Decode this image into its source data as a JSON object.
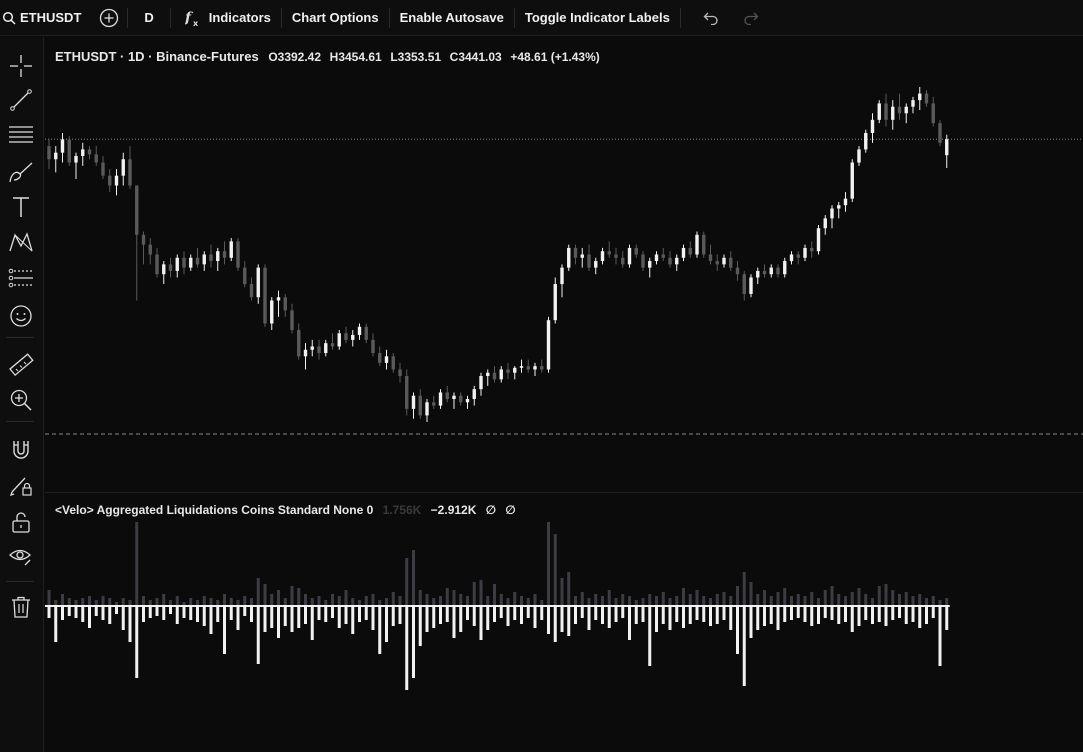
{
  "toolbar": {
    "symbol": "ETHUSDT",
    "interval": "D",
    "indicators_label": "Indicators",
    "chart_options_label": "Chart Options",
    "autosave_label": "Enable Autosave",
    "toggle_labels_label": "Toggle Indicator Labels"
  },
  "sidebar": {
    "tools": [
      "crosshair-icon",
      "trendline-icon",
      "fib-lines-icon",
      "brush-icon",
      "text-icon",
      "pattern-icon",
      "forecast-icon",
      "emoji-icon",
      "ruler-icon",
      "zoom-in-icon",
      "magnet-icon",
      "lock-drawing-icon",
      "unlock-icon",
      "eye-icon",
      "trash-icon"
    ]
  },
  "legend": {
    "title": "ETHUSDT · 1D · Binance-Futures",
    "open": "O3392.42",
    "high": "H3454.61",
    "low": "L3353.51",
    "close": "C3441.03",
    "change": "+48.61 (+1.43%)"
  },
  "indicator": {
    "name": "<Velo> Aggregated Liquidations Coins Standard None 0",
    "value1": "1.756K",
    "value2": "−2.912K",
    "value3": "∅",
    "value4": "∅"
  },
  "chart_data": {
    "type": "candlestick",
    "ohlc": [
      [
        3420,
        3440,
        3350,
        3380
      ],
      [
        3380,
        3420,
        3340,
        3400
      ],
      [
        3400,
        3460,
        3370,
        3440
      ],
      [
        3440,
        3450,
        3360,
        3370
      ],
      [
        3370,
        3400,
        3320,
        3390
      ],
      [
        3390,
        3430,
        3360,
        3410
      ],
      [
        3410,
        3420,
        3380,
        3395
      ],
      [
        3395,
        3420,
        3360,
        3370
      ],
      [
        3370,
        3390,
        3320,
        3330
      ],
      [
        3330,
        3350,
        3280,
        3300
      ],
      [
        3300,
        3350,
        3270,
        3330
      ],
      [
        3330,
        3400,
        3300,
        3380
      ],
      [
        3380,
        3420,
        3290,
        3300
      ],
      [
        3300,
        3300,
        2950,
        3150
      ],
      [
        3150,
        3160,
        3060,
        3120
      ],
      [
        3120,
        3140,
        3060,
        3090
      ],
      [
        3090,
        3110,
        3020,
        3030
      ],
      [
        3030,
        3070,
        3000,
        3060
      ],
      [
        3060,
        3080,
        3020,
        3040
      ],
      [
        3040,
        3090,
        3020,
        3080
      ],
      [
        3080,
        3100,
        3030,
        3050
      ],
      [
        3050,
        3090,
        3040,
        3080
      ],
      [
        3080,
        3110,
        3050,
        3060
      ],
      [
        3060,
        3100,
        3040,
        3090
      ],
      [
        3090,
        3120,
        3050,
        3070
      ],
      [
        3070,
        3110,
        3040,
        3100
      ],
      [
        3100,
        3130,
        3060,
        3080
      ],
      [
        3080,
        3140,
        3070,
        3130
      ],
      [
        3130,
        3140,
        3040,
        3050
      ],
      [
        3050,
        3070,
        2990,
        3000
      ],
      [
        3000,
        3020,
        2950,
        2960
      ],
      [
        2960,
        3060,
        2940,
        3050
      ],
      [
        3050,
        3060,
        2870,
        2880
      ],
      [
        2880,
        2960,
        2860,
        2950
      ],
      [
        2950,
        2980,
        2900,
        2960
      ],
      [
        2960,
        2970,
        2900,
        2920
      ],
      [
        2920,
        2940,
        2850,
        2860
      ],
      [
        2860,
        2880,
        2770,
        2780
      ],
      [
        2780,
        2820,
        2740,
        2800
      ],
      [
        2800,
        2830,
        2780,
        2810
      ],
      [
        2810,
        2830,
        2770,
        2790
      ],
      [
        2790,
        2830,
        2780,
        2820
      ],
      [
        2820,
        2850,
        2800,
        2810
      ],
      [
        2810,
        2860,
        2800,
        2850
      ],
      [
        2850,
        2870,
        2820,
        2830
      ],
      [
        2830,
        2860,
        2810,
        2845
      ],
      [
        2845,
        2880,
        2830,
        2870
      ],
      [
        2870,
        2880,
        2820,
        2830
      ],
      [
        2830,
        2850,
        2780,
        2790
      ],
      [
        2790,
        2810,
        2750,
        2760
      ],
      [
        2760,
        2800,
        2740,
        2780
      ],
      [
        2780,
        2790,
        2730,
        2740
      ],
      [
        2740,
        2760,
        2700,
        2720
      ],
      [
        2720,
        2740,
        2600,
        2620
      ],
      [
        2620,
        2670,
        2590,
        2660
      ],
      [
        2660,
        2680,
        2590,
        2600
      ],
      [
        2600,
        2650,
        2580,
        2640
      ],
      [
        2640,
        2660,
        2620,
        2630
      ],
      [
        2630,
        2680,
        2620,
        2670
      ],
      [
        2670,
        2690,
        2640,
        2650
      ],
      [
        2650,
        2670,
        2620,
        2660
      ],
      [
        2660,
        2670,
        2630,
        2640
      ],
      [
        2640,
        2660,
        2620,
        2650
      ],
      [
        2650,
        2690,
        2630,
        2680
      ],
      [
        2680,
        2730,
        2660,
        2720
      ],
      [
        2720,
        2740,
        2690,
        2730
      ],
      [
        2730,
        2750,
        2700,
        2710
      ],
      [
        2710,
        2750,
        2700,
        2740
      ],
      [
        2740,
        2760,
        2710,
        2730
      ],
      [
        2730,
        2750,
        2710,
        2745
      ],
      [
        2745,
        2770,
        2730,
        2750
      ],
      [
        2750,
        2770,
        2730,
        2740
      ],
      [
        2740,
        2760,
        2720,
        2750
      ],
      [
        2750,
        2770,
        2730,
        2740
      ],
      [
        2740,
        2900,
        2730,
        2890
      ],
      [
        2890,
        3020,
        2880,
        3000
      ],
      [
        3000,
        3060,
        2960,
        3050
      ],
      [
        3050,
        3120,
        3040,
        3110
      ],
      [
        3110,
        3120,
        3060,
        3080
      ],
      [
        3080,
        3110,
        3050,
        3090
      ],
      [
        3090,
        3120,
        3040,
        3050
      ],
      [
        3050,
        3080,
        3030,
        3070
      ],
      [
        3070,
        3110,
        3060,
        3100
      ],
      [
        3100,
        3130,
        3080,
        3090
      ],
      [
        3090,
        3110,
        3060,
        3080
      ],
      [
        3080,
        3100,
        3050,
        3060
      ],
      [
        3060,
        3120,
        3050,
        3110
      ],
      [
        3110,
        3120,
        3080,
        3090
      ],
      [
        3090,
        3100,
        3040,
        3050
      ],
      [
        3050,
        3080,
        3020,
        3070
      ],
      [
        3070,
        3100,
        3060,
        3090
      ],
      [
        3090,
        3110,
        3070,
        3080
      ],
      [
        3080,
        3100,
        3050,
        3060
      ],
      [
        3060,
        3090,
        3040,
        3080
      ],
      [
        3080,
        3120,
        3070,
        3110
      ],
      [
        3110,
        3130,
        3080,
        3090
      ],
      [
        3090,
        3160,
        3080,
        3150
      ],
      [
        3150,
        3160,
        3080,
        3090
      ],
      [
        3090,
        3120,
        3060,
        3070
      ],
      [
        3070,
        3090,
        3040,
        3060
      ],
      [
        3060,
        3090,
        3050,
        3080
      ],
      [
        3080,
        3100,
        3040,
        3050
      ],
      [
        3050,
        3070,
        3010,
        3030
      ],
      [
        3030,
        3040,
        2950,
        2970
      ],
      [
        2970,
        3030,
        2960,
        3020
      ],
      [
        3020,
        3050,
        3000,
        3040
      ],
      [
        3040,
        3060,
        3020,
        3030
      ],
      [
        3030,
        3060,
        3020,
        3050
      ],
      [
        3050,
        3060,
        3020,
        3030
      ],
      [
        3030,
        3080,
        3020,
        3070
      ],
      [
        3070,
        3100,
        3060,
        3090
      ],
      [
        3090,
        3100,
        3060,
        3080
      ],
      [
        3080,
        3120,
        3070,
        3110
      ],
      [
        3110,
        3130,
        3080,
        3100
      ],
      [
        3100,
        3180,
        3090,
        3170
      ],
      [
        3170,
        3210,
        3150,
        3200
      ],
      [
        3200,
        3240,
        3170,
        3230
      ],
      [
        3230,
        3250,
        3200,
        3240
      ],
      [
        3240,
        3280,
        3220,
        3260
      ],
      [
        3260,
        3380,
        3250,
        3370
      ],
      [
        3370,
        3420,
        3360,
        3410
      ],
      [
        3410,
        3470,
        3400,
        3460
      ],
      [
        3460,
        3520,
        3430,
        3500
      ],
      [
        3500,
        3560,
        3490,
        3550
      ],
      [
        3550,
        3580,
        3480,
        3500
      ],
      [
        3500,
        3560,
        3470,
        3540
      ],
      [
        3540,
        3580,
        3500,
        3520
      ],
      [
        3520,
        3550,
        3490,
        3540
      ],
      [
        3540,
        3570,
        3520,
        3560
      ],
      [
        3560,
        3600,
        3530,
        3580
      ],
      [
        3580,
        3590,
        3540,
        3550
      ],
      [
        3550,
        3570,
        3480,
        3490
      ],
      [
        3490,
        3500,
        3420,
        3430
      ],
      [
        3392.42,
        3454.61,
        3353.51,
        3441.03
      ]
    ],
    "liquidations": {
      "positive": [
        0.8,
        0.3,
        0.6,
        0.4,
        0.3,
        0.4,
        0.5,
        0.3,
        0.5,
        0.4,
        0.2,
        0.4,
        0.3,
        4.2,
        0.5,
        0.3,
        0.4,
        0.6,
        0.3,
        0.5,
        0.2,
        0.4,
        0.3,
        0.5,
        0.4,
        0.3,
        0.6,
        0.4,
        0.3,
        0.5,
        0.4,
        1.4,
        1.1,
        0.6,
        0.8,
        0.4,
        1.0,
        0.9,
        0.6,
        0.4,
        0.5,
        0.3,
        0.6,
        0.5,
        0.8,
        0.4,
        0.3,
        0.5,
        0.6,
        0.3,
        0.4,
        0.7,
        0.5,
        2.4,
        2.8,
        0.8,
        0.6,
        0.4,
        0.5,
        0.9,
        0.8,
        0.6,
        0.5,
        1.2,
        1.3,
        0.5,
        1.1,
        0.6,
        0.4,
        0.7,
        0.5,
        0.4,
        0.6,
        0.3,
        4.2,
        3.6,
        1.4,
        1.7,
        0.5,
        0.7,
        0.4,
        0.6,
        0.5,
        0.8,
        0.4,
        0.6,
        0.5,
        0.3,
        0.4,
        0.6,
        0.5,
        0.7,
        0.4,
        0.5,
        0.9,
        0.6,
        0.8,
        0.5,
        0.4,
        0.6,
        0.7,
        0.5,
        1.0,
        1.7,
        1.2,
        0.6,
        0.8,
        0.5,
        0.7,
        0.9,
        0.5,
        0.6,
        0.5,
        0.7,
        0.4,
        0.8,
        1.0,
        0.6,
        0.5,
        0.7,
        0.9,
        0.6,
        0.4,
        1.0,
        1.1,
        0.8,
        0.6,
        0.7,
        0.5,
        0.6,
        0.4,
        0.5,
        0.3,
        0.4,
        0.3
      ],
      "negative": [
        0.6,
        1.8,
        0.7,
        0.5,
        0.6,
        0.8,
        1.1,
        0.5,
        0.7,
        0.9,
        0.4,
        1.2,
        1.8,
        3.6,
        0.8,
        0.6,
        0.5,
        0.7,
        0.4,
        0.9,
        0.6,
        0.7,
        0.8,
        1.0,
        1.4,
        0.8,
        2.4,
        0.7,
        1.2,
        0.5,
        0.8,
        2.9,
        1.3,
        1.1,
        1.6,
        1.0,
        1.3,
        1.1,
        0.9,
        1.7,
        0.7,
        0.8,
        0.6,
        1.1,
        0.9,
        1.4,
        0.8,
        0.7,
        1.2,
        2.4,
        1.8,
        1.0,
        0.9,
        4.2,
        3.6,
        2.0,
        1.3,
        1.1,
        0.9,
        0.8,
        1.6,
        1.3,
        0.7,
        1.0,
        1.7,
        1.2,
        0.8,
        0.6,
        1.0,
        0.7,
        0.9,
        0.6,
        1.1,
        0.7,
        1.4,
        1.8,
        1.3,
        1.5,
        0.9,
        0.6,
        1.2,
        0.7,
        0.9,
        1.1,
        0.8,
        0.6,
        1.7,
        0.9,
        0.8,
        3.0,
        1.3,
        0.9,
        1.2,
        0.8,
        1.1,
        0.9,
        0.7,
        0.8,
        1.0,
        0.9,
        0.7,
        1.2,
        2.4,
        4.0,
        1.6,
        1.2,
        1.0,
        0.9,
        1.2,
        0.8,
        0.7,
        0.6,
        0.8,
        1.0,
        0.9,
        0.6,
        0.7,
        0.9,
        0.8,
        1.3,
        1.0,
        0.7,
        0.9,
        0.8,
        1.0,
        0.7,
        0.6,
        0.9,
        0.8,
        1.1,
        0.9,
        0.6,
        3.0,
        1.2,
        0.5
      ]
    }
  }
}
